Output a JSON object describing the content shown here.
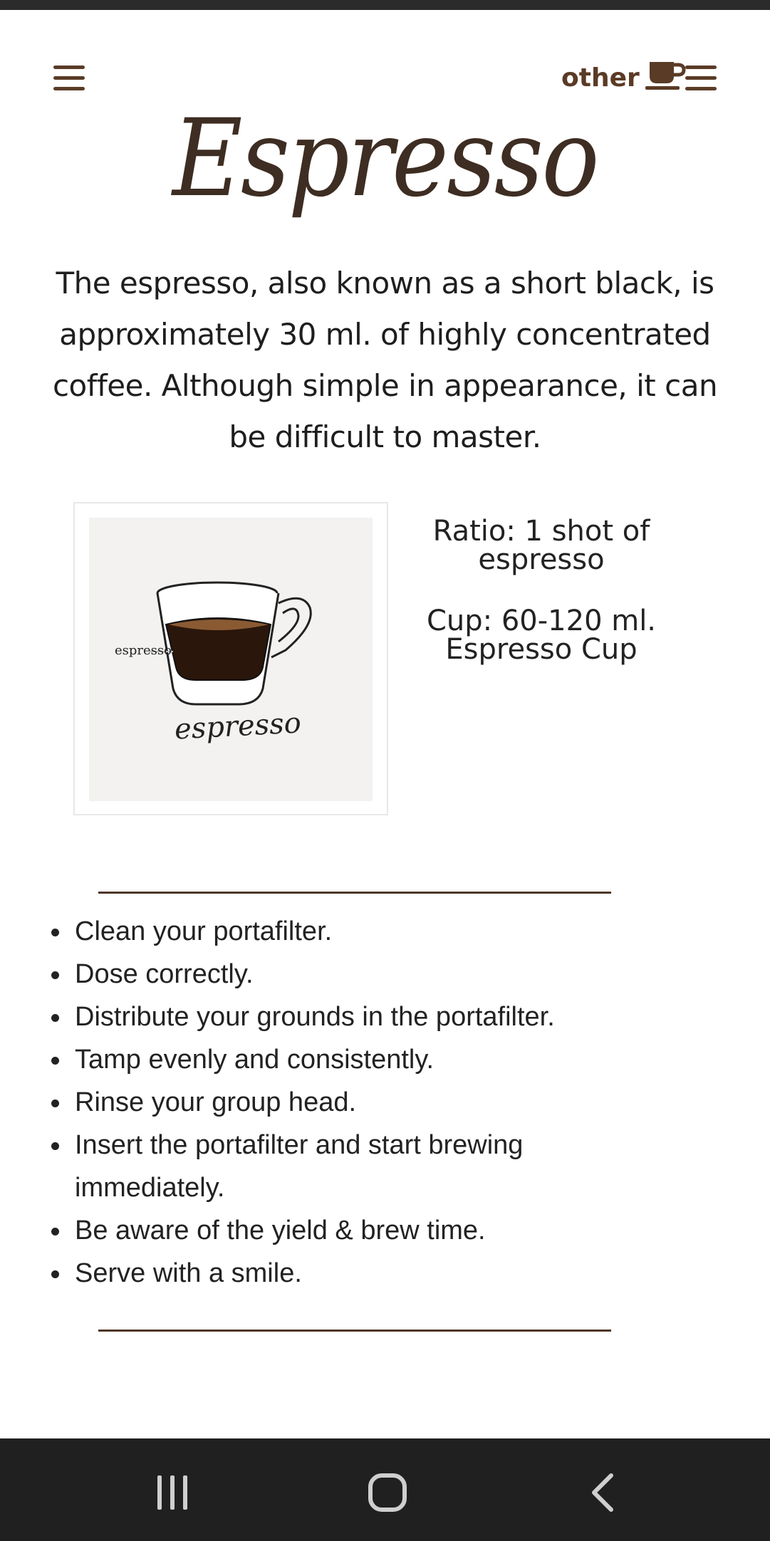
{
  "header": {
    "other_label": "other"
  },
  "page": {
    "title": "Espresso",
    "intro": "The espresso, also known as a short black, is approximately 30 ml. of highly concentrated coffee. Although simple in appearance, it can be difficult to master."
  },
  "illustration": {
    "side_label": "espresso",
    "caption": "espresso"
  },
  "specs": {
    "ratio": "Ratio: 1 shot of espresso",
    "cup": "Cup: 60-120 ml. Espresso Cup"
  },
  "steps": [
    "Clean your portafilter.",
    "Dose correctly.",
    "Distribute your grounds in the portafilter.",
    "Tamp evenly and consistently.",
    "Rinse your group head.",
    "Insert the portafilter and start brewing immediately.",
    "Be aware of the yield & brew time.",
    "Serve with a smile."
  ],
  "colors": {
    "accent": "#5a3b26",
    "title": "#3e2d22",
    "coffee": "#2a160b"
  }
}
